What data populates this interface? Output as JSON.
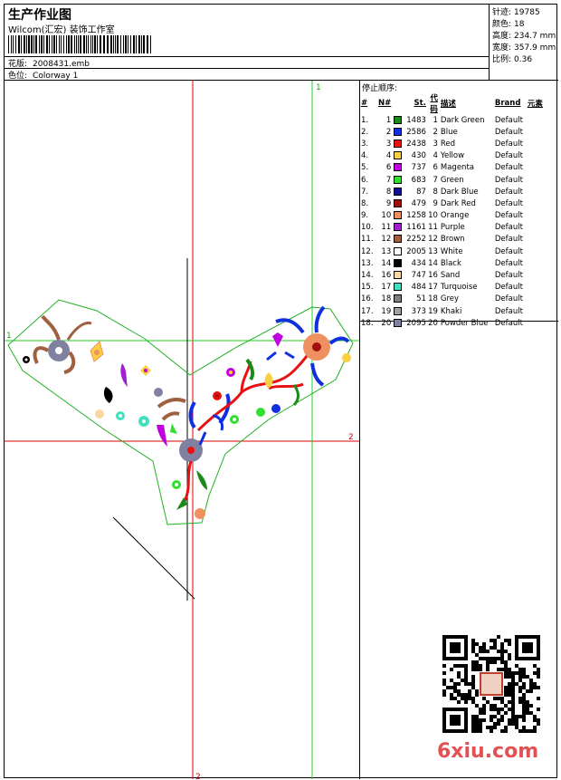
{
  "header": {
    "title": "生产作业图",
    "company": "Wilcom(汇宏) 装饰工作室",
    "design_label": "花版:",
    "design_value": "2008431.emb",
    "colorway_label": "色位:",
    "colorway_value": "Colorway 1"
  },
  "stats": [
    {
      "label": "针迹:",
      "value": "19785"
    },
    {
      "label": "颜色:",
      "value": "18"
    },
    {
      "label": "高度:",
      "value": "234.7 mm"
    },
    {
      "label": "宽度:",
      "value": "357.9 mm"
    },
    {
      "label": "比例:",
      "value": "0.36"
    }
  ],
  "guides": {
    "v1": "1",
    "h1": "1",
    "h2": "2",
    "v2": "2"
  },
  "stop_sequence_title": "停止顺序:",
  "table_headers": [
    "#",
    "N#",
    "St.",
    "代码",
    "描述",
    "Brand",
    "元素"
  ],
  "colors": [
    {
      "n": "1.",
      "needle": "1",
      "color": "#1a8a1a",
      "st": "1483",
      "code": "1",
      "desc": "Dark Green",
      "brand": "Default"
    },
    {
      "n": "2.",
      "needle": "2",
      "color": "#1030e0",
      "st": "2586",
      "code": "2",
      "desc": "Blue",
      "brand": "Default"
    },
    {
      "n": "3.",
      "needle": "3",
      "color": "#e81010",
      "st": "2438",
      "code": "3",
      "desc": "Red",
      "brand": "Default"
    },
    {
      "n": "4.",
      "needle": "4",
      "color": "#f8d040",
      "st": "430",
      "code": "4",
      "desc": "Yellow",
      "brand": "Default"
    },
    {
      "n": "5.",
      "needle": "6",
      "color": "#c000e0",
      "st": "737",
      "code": "6",
      "desc": "Magenta",
      "brand": "Default"
    },
    {
      "n": "6.",
      "needle": "7",
      "color": "#30e030",
      "st": "683",
      "code": "7",
      "desc": "Green",
      "brand": "Default"
    },
    {
      "n": "7.",
      "needle": "8",
      "color": "#101090",
      "st": "87",
      "code": "8",
      "desc": "Dark Blue",
      "brand": "Default"
    },
    {
      "n": "8.",
      "needle": "9",
      "color": "#a01010",
      "st": "479",
      "code": "9",
      "desc": "Dark Red",
      "brand": "Default"
    },
    {
      "n": "9.",
      "needle": "10",
      "color": "#f09060",
      "st": "1258",
      "code": "10",
      "desc": "Orange",
      "brand": "Default"
    },
    {
      "n": "10.",
      "needle": "11",
      "color": "#a020d0",
      "st": "1161",
      "code": "11",
      "desc": "Purple",
      "brand": "Default"
    },
    {
      "n": "11.",
      "needle": "12",
      "color": "#a06040",
      "st": "2252",
      "code": "12",
      "desc": "Brown",
      "brand": "Default"
    },
    {
      "n": "12.",
      "needle": "13",
      "color": "#ffffff",
      "st": "2005",
      "code": "13",
      "desc": "White",
      "brand": "Default"
    },
    {
      "n": "13.",
      "needle": "14",
      "color": "#000000",
      "st": "434",
      "code": "14",
      "desc": "Black",
      "brand": "Default"
    },
    {
      "n": "14.",
      "needle": "16",
      "color": "#f8d8a0",
      "st": "747",
      "code": "16",
      "desc": "Sand",
      "brand": "Default"
    },
    {
      "n": "15.",
      "needle": "17",
      "color": "#40e0c0",
      "st": "484",
      "code": "17",
      "desc": "Turquoise",
      "brand": "Default"
    },
    {
      "n": "16.",
      "needle": "18",
      "color": "#808080",
      "st": "51",
      "code": "18",
      "desc": "Grey",
      "brand": "Default"
    },
    {
      "n": "17.",
      "needle": "19",
      "color": "#a0a0a0",
      "st": "373",
      "code": "19",
      "desc": "Khaki",
      "brand": "Default"
    },
    {
      "n": "18.",
      "needle": "20",
      "color": "#8080a0",
      "st": "2095",
      "code": "20",
      "desc": "Powder Blue",
      "brand": "Default"
    }
  ],
  "watermark": "6xiu.com"
}
